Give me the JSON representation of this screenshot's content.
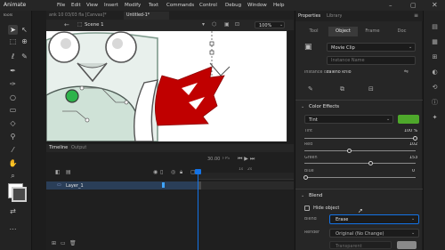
{
  "app": {
    "name": "Animate",
    "menu": [
      "File",
      "Edit",
      "View",
      "Insert",
      "Modify",
      "Text",
      "Commands",
      "Control",
      "Debug",
      "Window",
      "Help"
    ]
  },
  "tabs": [
    "ank 10 03/03 fla [Canvas]*",
    "Untitled-1*"
  ],
  "scene": {
    "label": "Scene 1",
    "zoom": "100%"
  },
  "tools_panel": {
    "title": "Tools"
  },
  "timeline": {
    "tabs": [
      "Timeline",
      "Output"
    ],
    "fps": "30.00",
    "fps_unit": "FPS",
    "frame_markers": [
      "1s",
      "2s"
    ],
    "layer_name": "Layer_1"
  },
  "properties": {
    "panel_tabs": [
      "Properties",
      "Library"
    ],
    "tabs": [
      "Tool",
      "Object",
      "Frame",
      "Doc"
    ],
    "active_tab": "Object",
    "symbol_type": "Movie Clip",
    "instance_name_placeholder": "Instance Name",
    "instance_of_label": "Instance of:",
    "instance_of_value": "zaleno krilo",
    "color_effects": {
      "title": "Color Effects",
      "style": "Tint",
      "swatch": "#4ea82b",
      "tint_label": "Tint",
      "tint_value": "100 %",
      "tint_pct": 1.0,
      "red_label": "Red",
      "red_value": "102",
      "green_label": "Green",
      "green_value": "153",
      "blue_label": "Blue",
      "blue_value": "0"
    },
    "blend": {
      "title": "Blend",
      "hide_object_label": "Hide object",
      "blend_label": "Blend",
      "blend_value": "Erase",
      "render_label": "Render",
      "render_value": "Original (No Change)",
      "transparent_label": "Transparent"
    }
  },
  "colors": {
    "accent": "#1473e6",
    "wing_red": "#c00000",
    "tint_green": "#4ea82b"
  }
}
